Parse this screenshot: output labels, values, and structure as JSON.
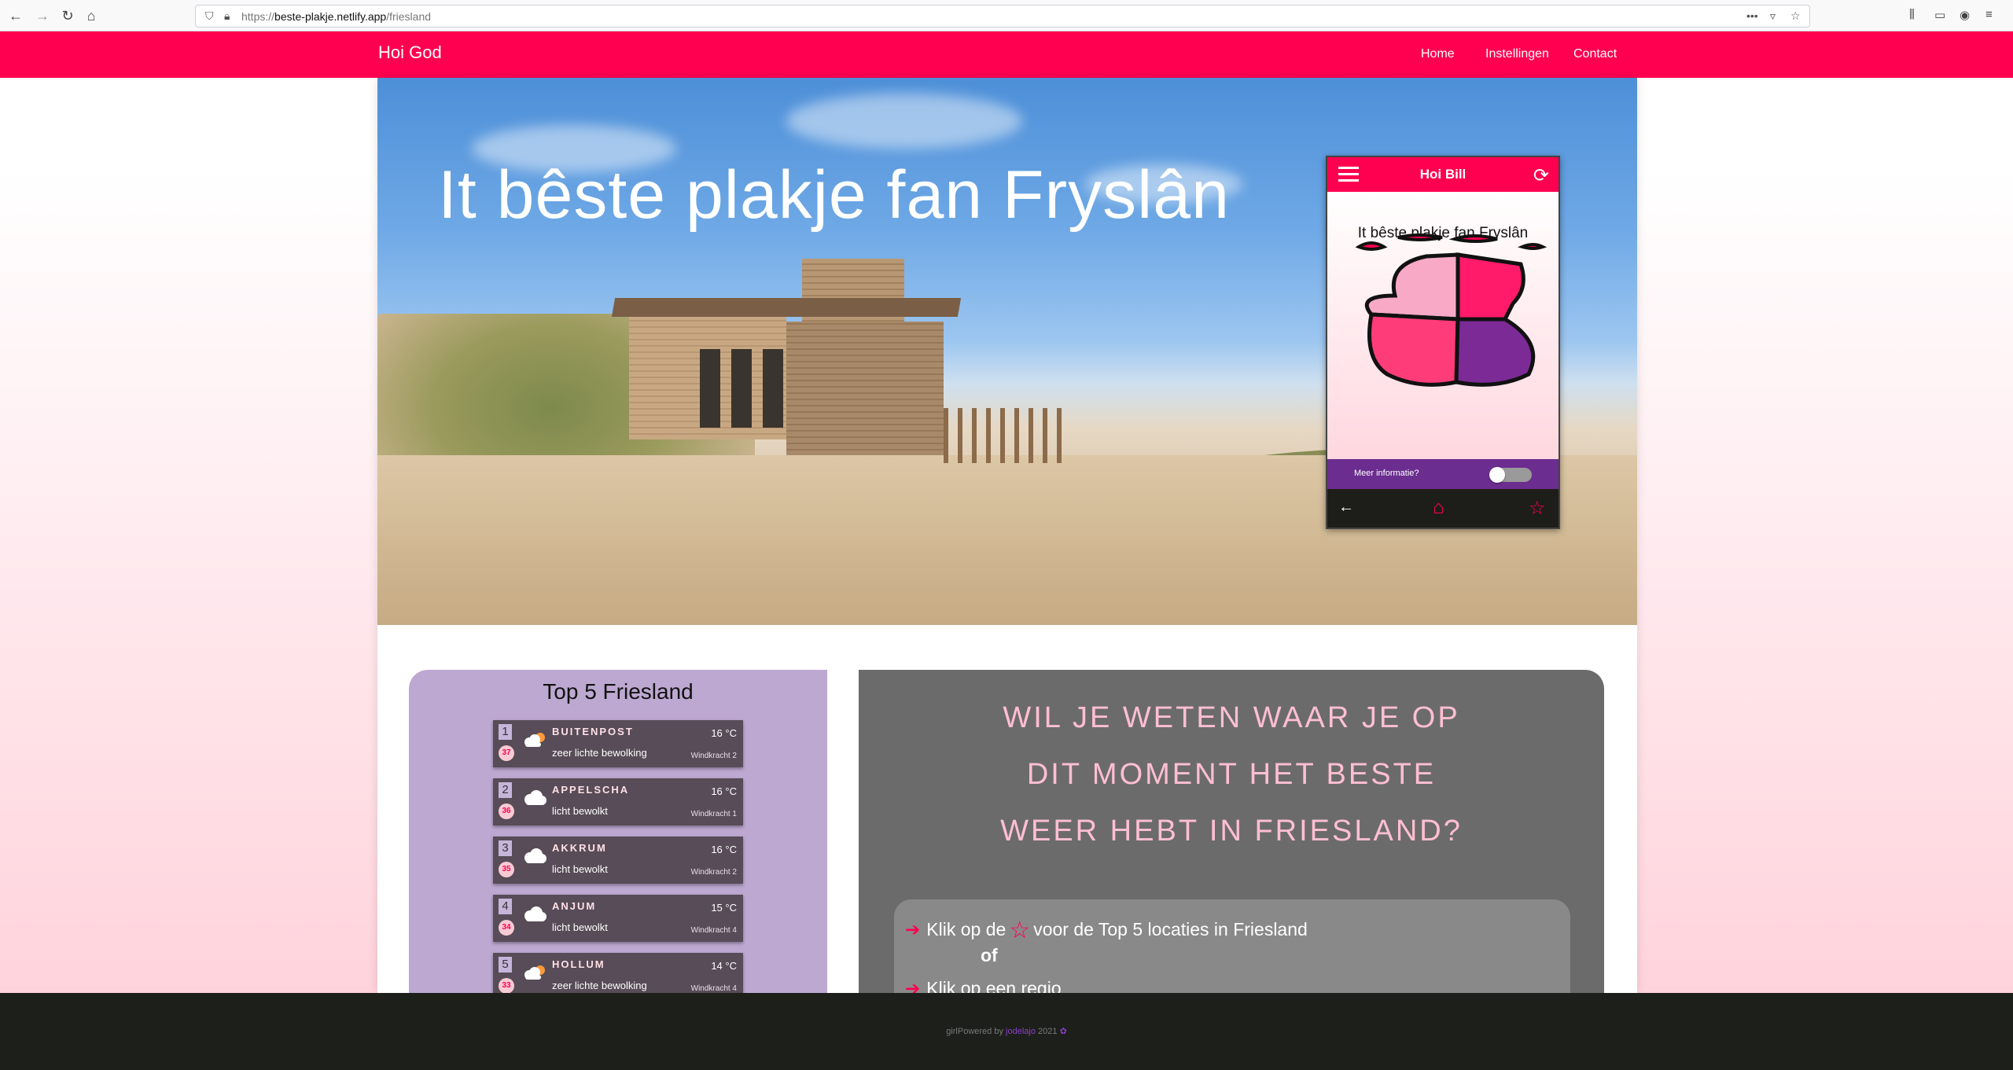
{
  "browser": {
    "url_prefix": "https://",
    "url_host": "beste-plakje.netlify.app",
    "url_path": "/friesland",
    "menu_dots": "•••"
  },
  "nav": {
    "brand": "Hoi God",
    "links": [
      "Home",
      "Instellingen",
      "Contact"
    ],
    "accent": "#ff0050"
  },
  "hero": {
    "title": "It bêste plakje fan Fryslân"
  },
  "phone": {
    "header_title": "Hoi Bill",
    "heading": "It bêste plakje fan Fryslân",
    "info_label": "Meer informatie?",
    "toggle_on": false
  },
  "top5": {
    "title": "Top 5 Friesland",
    "items": [
      {
        "rank": "1",
        "score": "37",
        "name": "BUITENPOST",
        "desc": "zeer lichte bewolking",
        "temp": "16 °C",
        "wind": "Windkracht 2",
        "icon": "sun-cloud-icon"
      },
      {
        "rank": "2",
        "score": "36",
        "name": "APPELSCHA",
        "desc": "licht bewolkt",
        "temp": "16 °C",
        "wind": "Windkracht 1",
        "icon": "cloud-icon"
      },
      {
        "rank": "3",
        "score": "35",
        "name": "AKKRUM",
        "desc": "licht bewolkt",
        "temp": "16 °C",
        "wind": "Windkracht 2",
        "icon": "cloud-icon"
      },
      {
        "rank": "4",
        "score": "34",
        "name": "ANJUM",
        "desc": "licht bewolkt",
        "temp": "15 °C",
        "wind": "Windkracht 4",
        "icon": "cloud-icon"
      },
      {
        "rank": "5",
        "score": "33",
        "name": "HOLLUM",
        "desc": "zeer lichte bewolking",
        "temp": "14 °C",
        "wind": "Windkracht 4",
        "icon": "sun-cloud-icon"
      }
    ]
  },
  "info": {
    "question_lines": [
      "WIL JE WETEN WAAR JE OP",
      "DIT MOMENT HET BESTE",
      "WEER HEBT IN FRIESLAND?"
    ],
    "line1_before": "Klik op de",
    "line1_after": "voor de Top 5 locaties in Friesland",
    "or": "of",
    "line2": "Klik op een regio"
  },
  "footer": {
    "prefix": "girlPowered by",
    "author": "jodelajo",
    "year": "2021"
  }
}
